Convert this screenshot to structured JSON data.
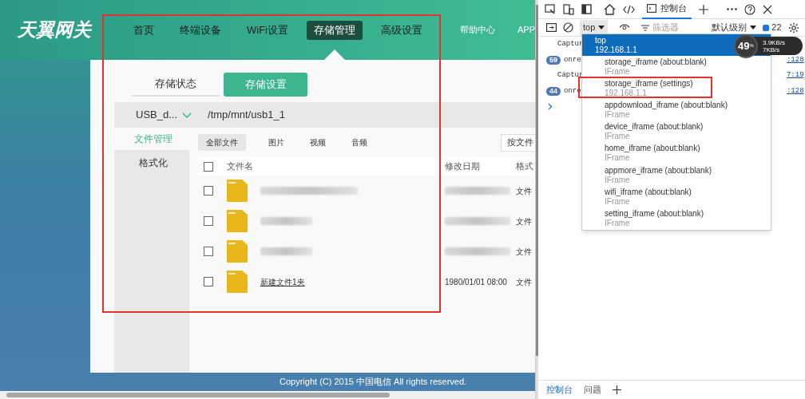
{
  "page": {
    "logo": "天翼网关",
    "nav": [
      {
        "label": "首页",
        "selected": false
      },
      {
        "label": "终端设备",
        "selected": false
      },
      {
        "label": "WiFi设置",
        "selected": false
      },
      {
        "label": "存储管理",
        "selected": true
      },
      {
        "label": "高级设置",
        "selected": false
      }
    ],
    "header_links": [
      "帮助中心",
      "APP"
    ],
    "subtabs": [
      {
        "label": "存储状态",
        "selected": false
      },
      {
        "label": "存储设置",
        "selected": true
      }
    ],
    "device": "USB_d...",
    "path": "/tmp/mnt/usb1_1",
    "side_menu": [
      {
        "label": "文件管理",
        "selected": true
      },
      {
        "label": "格式化",
        "selected": false
      }
    ],
    "filters": [
      {
        "label": "全部文件",
        "selected": true
      },
      {
        "label": "图片",
        "selected": false
      },
      {
        "label": "视频",
        "selected": false
      },
      {
        "label": "音频",
        "selected": false
      }
    ],
    "sort_field": "按文件",
    "table": {
      "columns": [
        "文件名",
        "修改日期",
        "格式"
      ],
      "header_checked": false,
      "rows": [
        {
          "kind": "blurred",
          "checked": false,
          "format": "文件"
        },
        {
          "kind": "blurred",
          "checked": false,
          "format": "文件"
        },
        {
          "kind": "blurred",
          "checked": false,
          "format": "文件"
        },
        {
          "kind": "text",
          "checked": false,
          "name": "新建文件1夹",
          "date": "1980/01/01 08:00",
          "format": "文件"
        }
      ]
    },
    "footer": "Copyright (C) 2015 中国电信 All rights reserved."
  },
  "devtools": {
    "tabs": [
      {
        "label": "控制台",
        "selected": true
      }
    ],
    "context": "top",
    "filter_placeholder": "筛选器",
    "level": "默认级别",
    "issues": "22",
    "console": [
      {
        "text": "Captur"
      },
      {
        "badge": "59",
        "text": "onre",
        "link": ":128"
      },
      {
        "text": "Captur",
        "link": "7:19"
      },
      {
        "badge": "44",
        "text": "onre",
        "link": ":128"
      }
    ],
    "dropdown": [
      {
        "name": "top",
        "sub": "192.168.1.1",
        "selected": true
      },
      {
        "name": "storage_iframe (about:blank)",
        "sub": "IFrame",
        "selected": false
      },
      {
        "name": "storage_iframe (settings)",
        "sub": "192.168.1.1",
        "selected": false
      },
      {
        "name": "appdownload_iframe (about:blank)",
        "sub": "IFrame",
        "selected": false
      },
      {
        "name": "device_iframe (about:blank)",
        "sub": "IFrame",
        "selected": false
      },
      {
        "name": "home_iframe (about:blank)",
        "sub": "IFrame",
        "selected": false
      },
      {
        "name": "appmore_iframe (about:blank)",
        "sub": "IFrame",
        "selected": false
      },
      {
        "name": "wifi_iframe (about:blank)",
        "sub": "IFrame",
        "selected": false
      },
      {
        "name": "setting_iframe (about:blank)",
        "sub": "IFrame",
        "selected": false
      }
    ],
    "monitor": {
      "percent": "49",
      "unit": "%",
      "up": "3.9KB/s",
      "down": "7KB/s"
    },
    "drawer_tabs": [
      {
        "label": "控制台",
        "selected": true
      },
      {
        "label": "问题",
        "selected": false
      }
    ]
  }
}
